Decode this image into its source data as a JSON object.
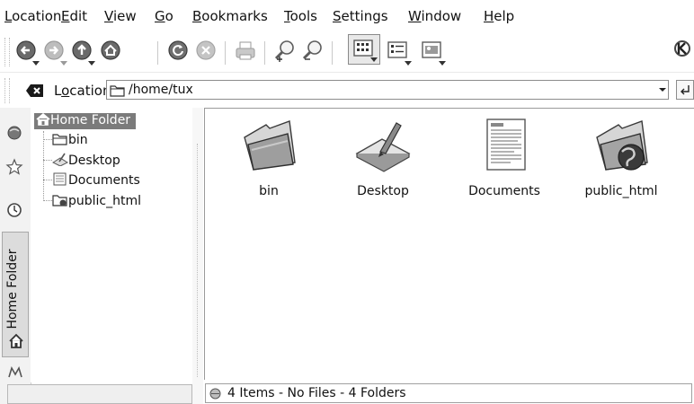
{
  "menubar": {
    "items": [
      "Location",
      "Edit",
      "View",
      "Go",
      "Bookmarks",
      "Tools",
      "Settings",
      "Window",
      "Help"
    ]
  },
  "toolbar": {
    "buttons": [
      "back-icon",
      "forward-icon",
      "up-icon",
      "home-icon",
      "reload-icon",
      "stop-icon",
      "print-icon",
      "zoom-in-icon",
      "zoom-out-icon",
      "icon-view-icon",
      "detail-view-icon",
      "image-view-icon"
    ],
    "logo": "kde-logo"
  },
  "location": {
    "label": "Location:",
    "value": "/home/tux"
  },
  "sidebar": {
    "vertical_tab_label": "Home Folder",
    "tree": {
      "root": "Home Folder",
      "children": [
        "bin",
        "Desktop",
        "Documents",
        "public_html"
      ]
    }
  },
  "iconview": {
    "items": [
      {
        "label": "bin",
        "icon": "folder-icon"
      },
      {
        "label": "Desktop",
        "icon": "desktop-icon"
      },
      {
        "label": "Documents",
        "icon": "documents-icon"
      },
      {
        "label": "public_html",
        "icon": "web-folder-icon"
      }
    ]
  },
  "status": {
    "text": "4 Items - No Files - 4 Folders"
  }
}
